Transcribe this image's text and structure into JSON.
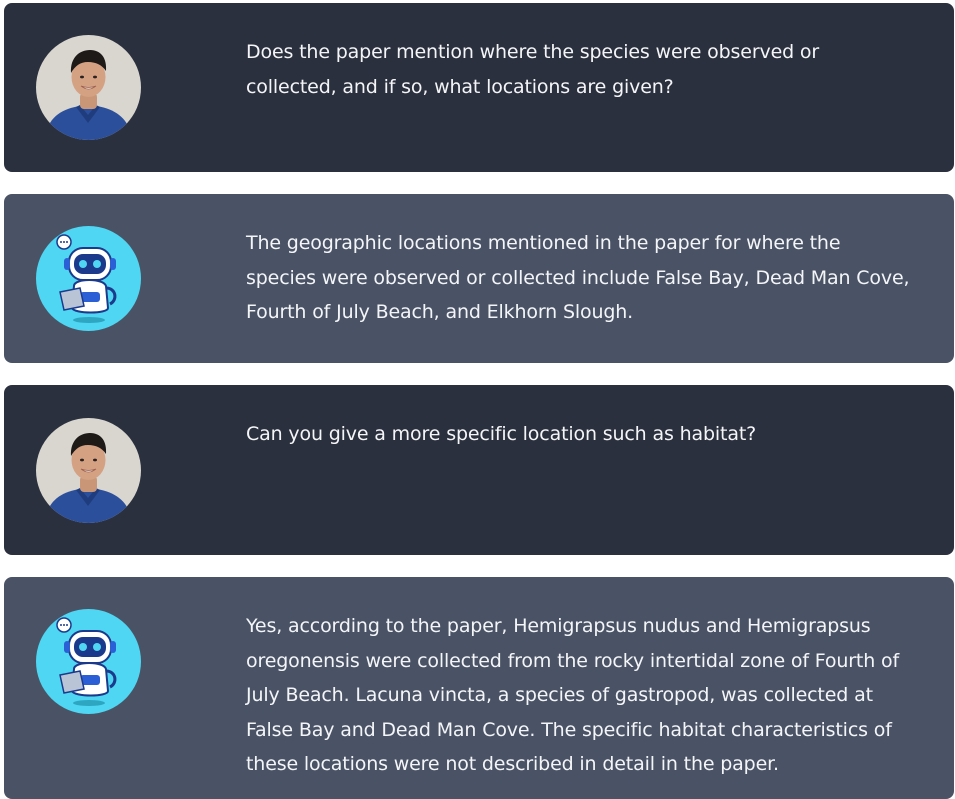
{
  "messages": [
    {
      "role": "user",
      "avatar": "user-photo-avatar",
      "text": "Does the paper mention where the species were observed or collected, and if so, what locations are given?"
    },
    {
      "role": "assistant",
      "avatar": "robot-avatar",
      "text": "The geographic locations mentioned in the paper for where the species were observed or collected include False Bay, Dead Man Cove, Fourth of July Beach, and Elkhorn Slough."
    },
    {
      "role": "user",
      "avatar": "user-photo-avatar",
      "text": "Can you give a more specific location such as habitat?"
    },
    {
      "role": "assistant",
      "avatar": "robot-avatar",
      "text": "Yes, according to the paper, Hemigrapsus nudus and Hemigrapsus oregonensis were collected from the rocky intertidal zone of Fourth of July Beach. Lacuna vincta, a species of gastropod, was collected at False Bay and Dead Man Cove. The specific habitat characteristics of these locations were not described in detail in the paper."
    }
  ],
  "colors": {
    "user_bubble": "#2b303e",
    "assistant_bubble": "#4a5366",
    "text": "#f4f5f7",
    "robot_avatar_bg": "#4fd6f2"
  }
}
